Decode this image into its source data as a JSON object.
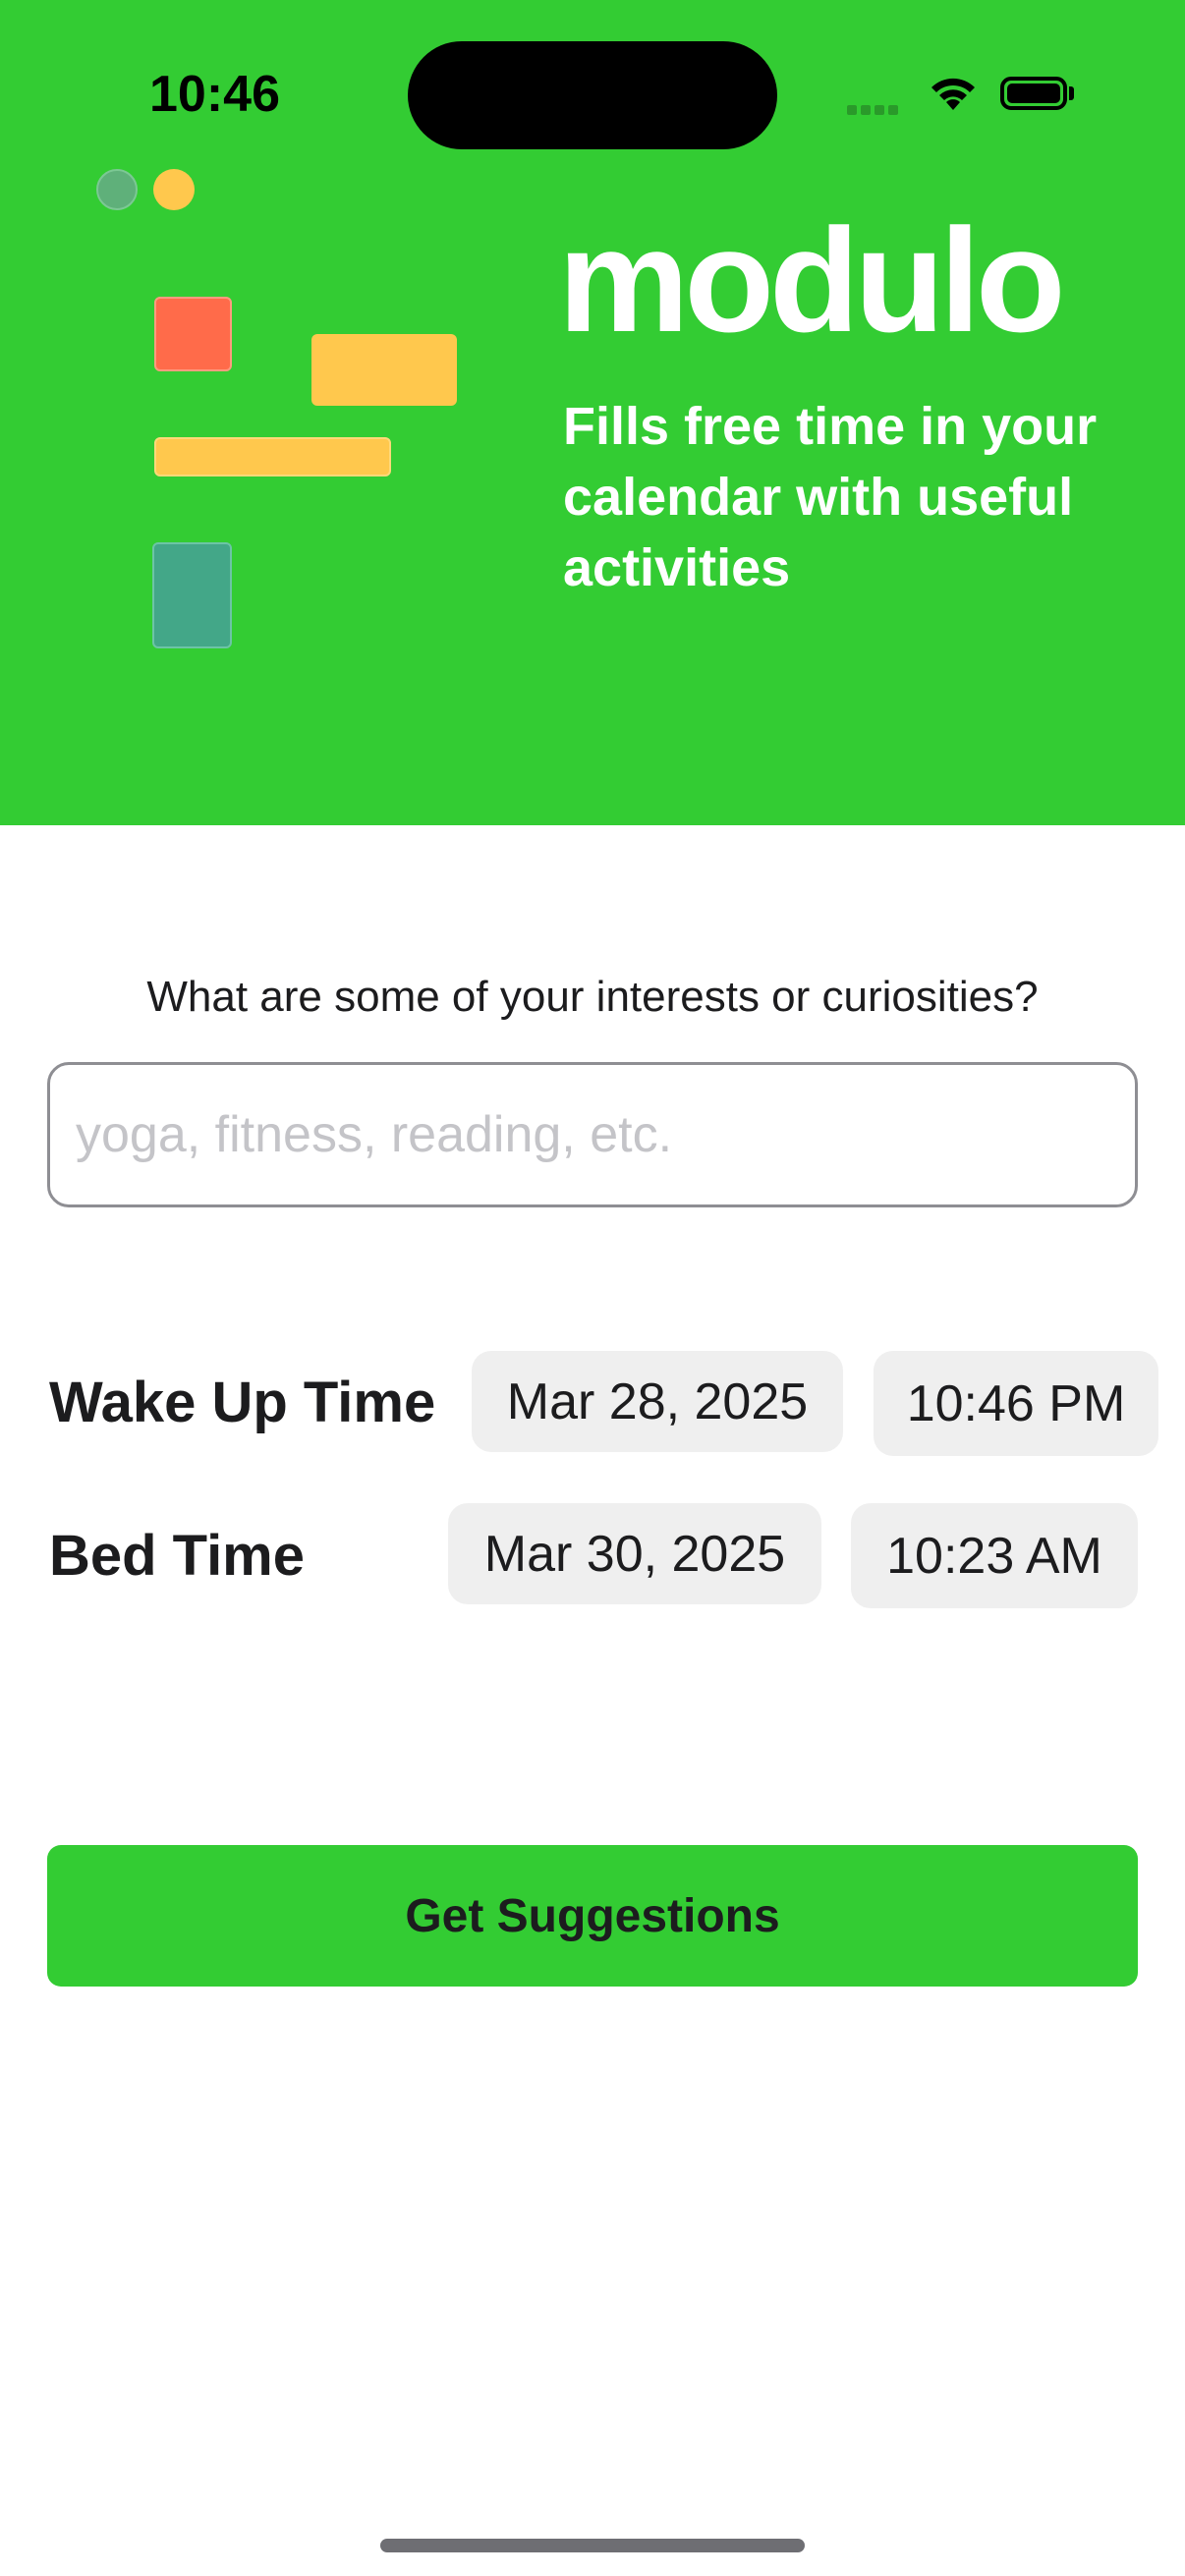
{
  "status_bar": {
    "time": "10:46"
  },
  "hero": {
    "app_name": "modulo",
    "tagline": "Fills free time in your calendar with useful activities",
    "background_color": "#33cc33",
    "illustration_colors": [
      "#ff6b4a",
      "#ffc84d",
      "#43a788",
      "#ffc84d"
    ]
  },
  "form": {
    "interests_question": "What are some of your interests or curiosities?",
    "interests_placeholder": "yoga, fitness, reading, etc.",
    "interests_value": "",
    "wake_up": {
      "label": "Wake Up Time",
      "date": "Mar 28, 2025",
      "time": "10:46 PM"
    },
    "bed": {
      "label": "Bed Time",
      "date": "Mar 30, 2025",
      "time": "10:23 AM"
    },
    "submit_label": "Get Suggestions"
  }
}
